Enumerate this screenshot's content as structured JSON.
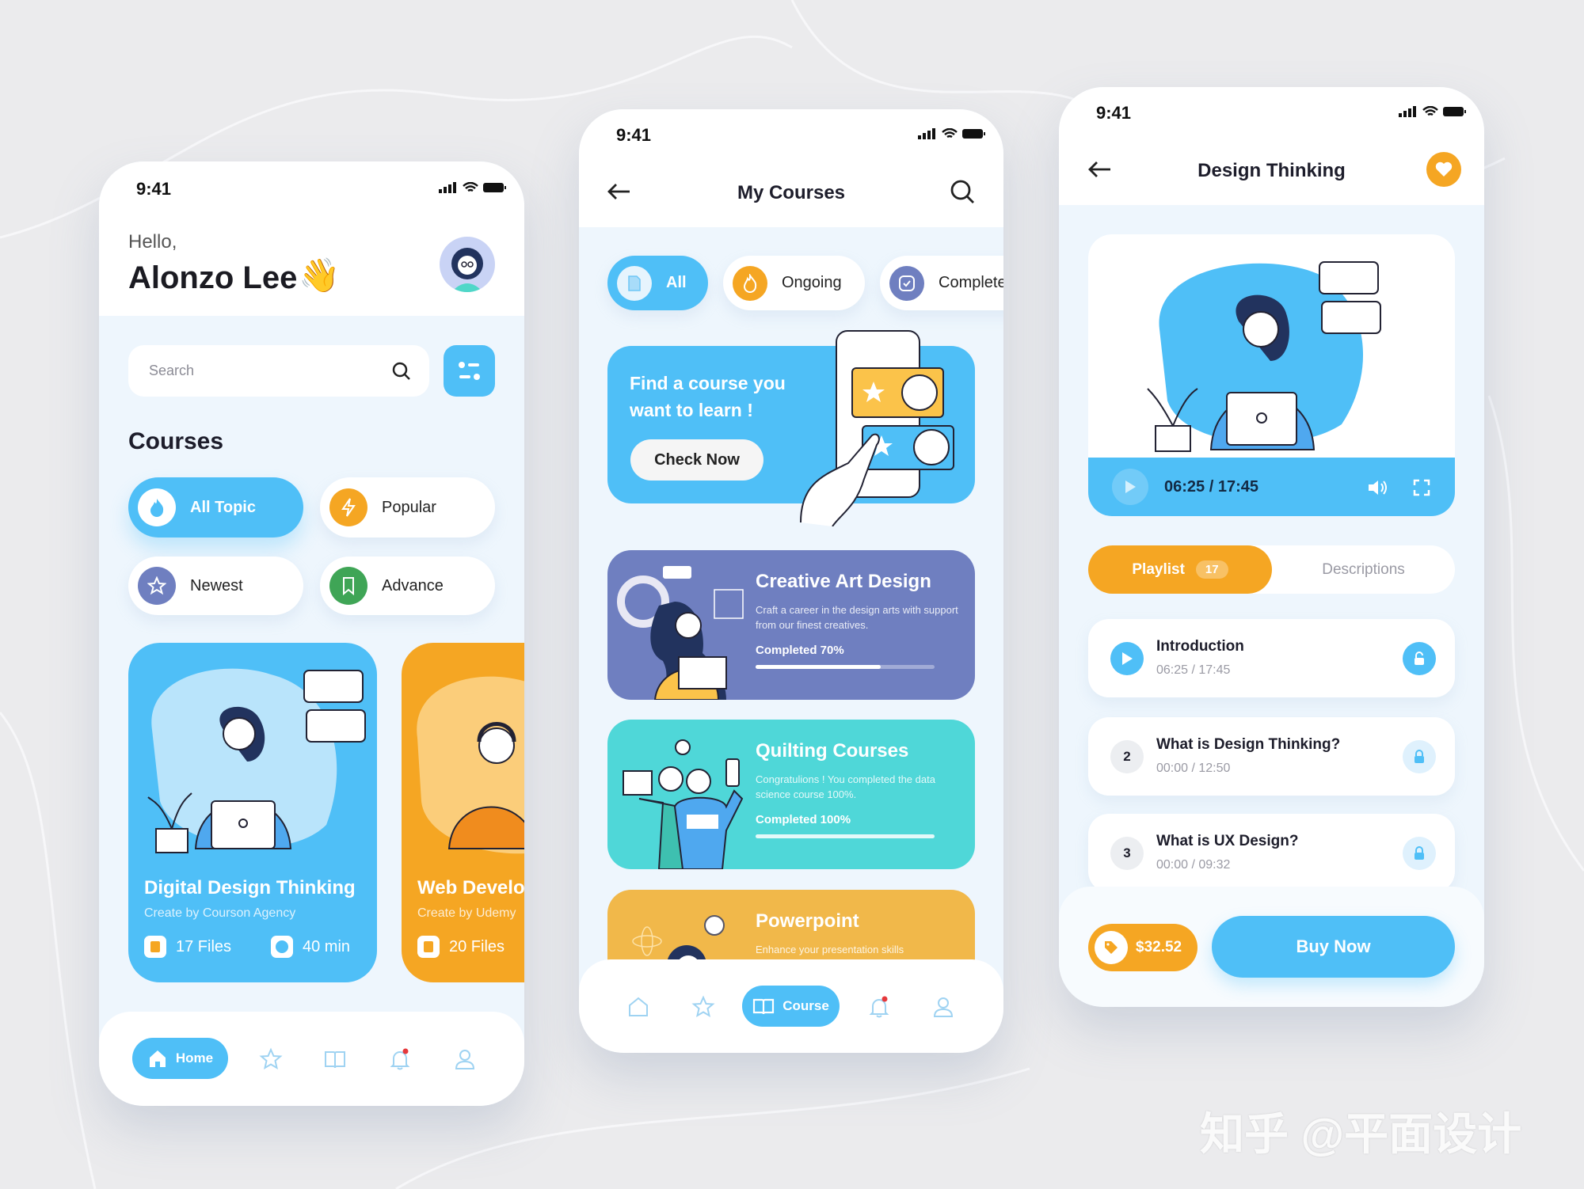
{
  "colors": {
    "primary": "#4fbff7",
    "orange": "#f5a623",
    "purple": "#6f7fc0",
    "green": "#3fa556",
    "teal": "#4fd7d8",
    "background": "#ebebed"
  },
  "home": {
    "status_time": "9:41",
    "greeting": "Hello,",
    "user_name": "Alonzo Lee",
    "search_placeholder": "Search",
    "section_title": "Courses",
    "chips": [
      {
        "label": "All Topic",
        "icon": "flame-icon",
        "selected": true
      },
      {
        "label": "Popular",
        "icon": "bolt-icon"
      },
      {
        "label": "Newest",
        "icon": "star-icon"
      },
      {
        "label": "Advance",
        "icon": "bookmark-icon"
      }
    ],
    "cards": [
      {
        "title": "Digital Design Thinking",
        "author": "Create by Courson Agency",
        "files": "17 Files",
        "duration": "40 min"
      },
      {
        "title": "Web Develo",
        "author": "Create by Udemy",
        "files": "20 Files"
      }
    ],
    "nav": {
      "active_label": "Home",
      "items": [
        "home-icon",
        "star-icon",
        "book-icon",
        "bell-icon",
        "user-icon"
      ]
    }
  },
  "my_courses": {
    "status_time": "9:41",
    "title": "My Courses",
    "tabs": [
      {
        "label": "All",
        "selected": true
      },
      {
        "label": "Ongoing"
      },
      {
        "label": "Complete"
      }
    ],
    "banner": {
      "line1": "Find a course you",
      "line2": "want to learn !",
      "button": "Check Now"
    },
    "courses": [
      {
        "title": "Creative Art Design",
        "description": "Craft a career in the design arts with support from our finest creatives.",
        "progress_label": "Completed 70%",
        "progress": 70
      },
      {
        "title": "Quilting Courses",
        "description": "Congratulions ! You completed the data science course 100%.",
        "progress_label": "Completed 100%",
        "progress": 100
      },
      {
        "title": "Powerpoint",
        "description": "Enhance your presentation skills"
      }
    ],
    "nav": {
      "active_label": "Course"
    }
  },
  "detail": {
    "status_time": "9:41",
    "title": "Design Thinking",
    "player": {
      "time": "06:25 / 17:45",
      "progress": 36
    },
    "tabs": {
      "playlist": "Playlist",
      "playlist_count": "17",
      "descriptions": "Descriptions"
    },
    "lessons": [
      {
        "index": "",
        "title": "Introduction",
        "time": "06:25 / 17:45",
        "unlocked": true
      },
      {
        "index": "2",
        "title": "What is Design Thinking?",
        "time": "00:00 / 12:50",
        "unlocked": false
      },
      {
        "index": "3",
        "title": "What is UX Design?",
        "time": "00:00 / 09:32",
        "unlocked": false
      }
    ],
    "price": "$32.52",
    "buy_label": "Buy Now"
  },
  "watermark": "知乎 @平面设计"
}
